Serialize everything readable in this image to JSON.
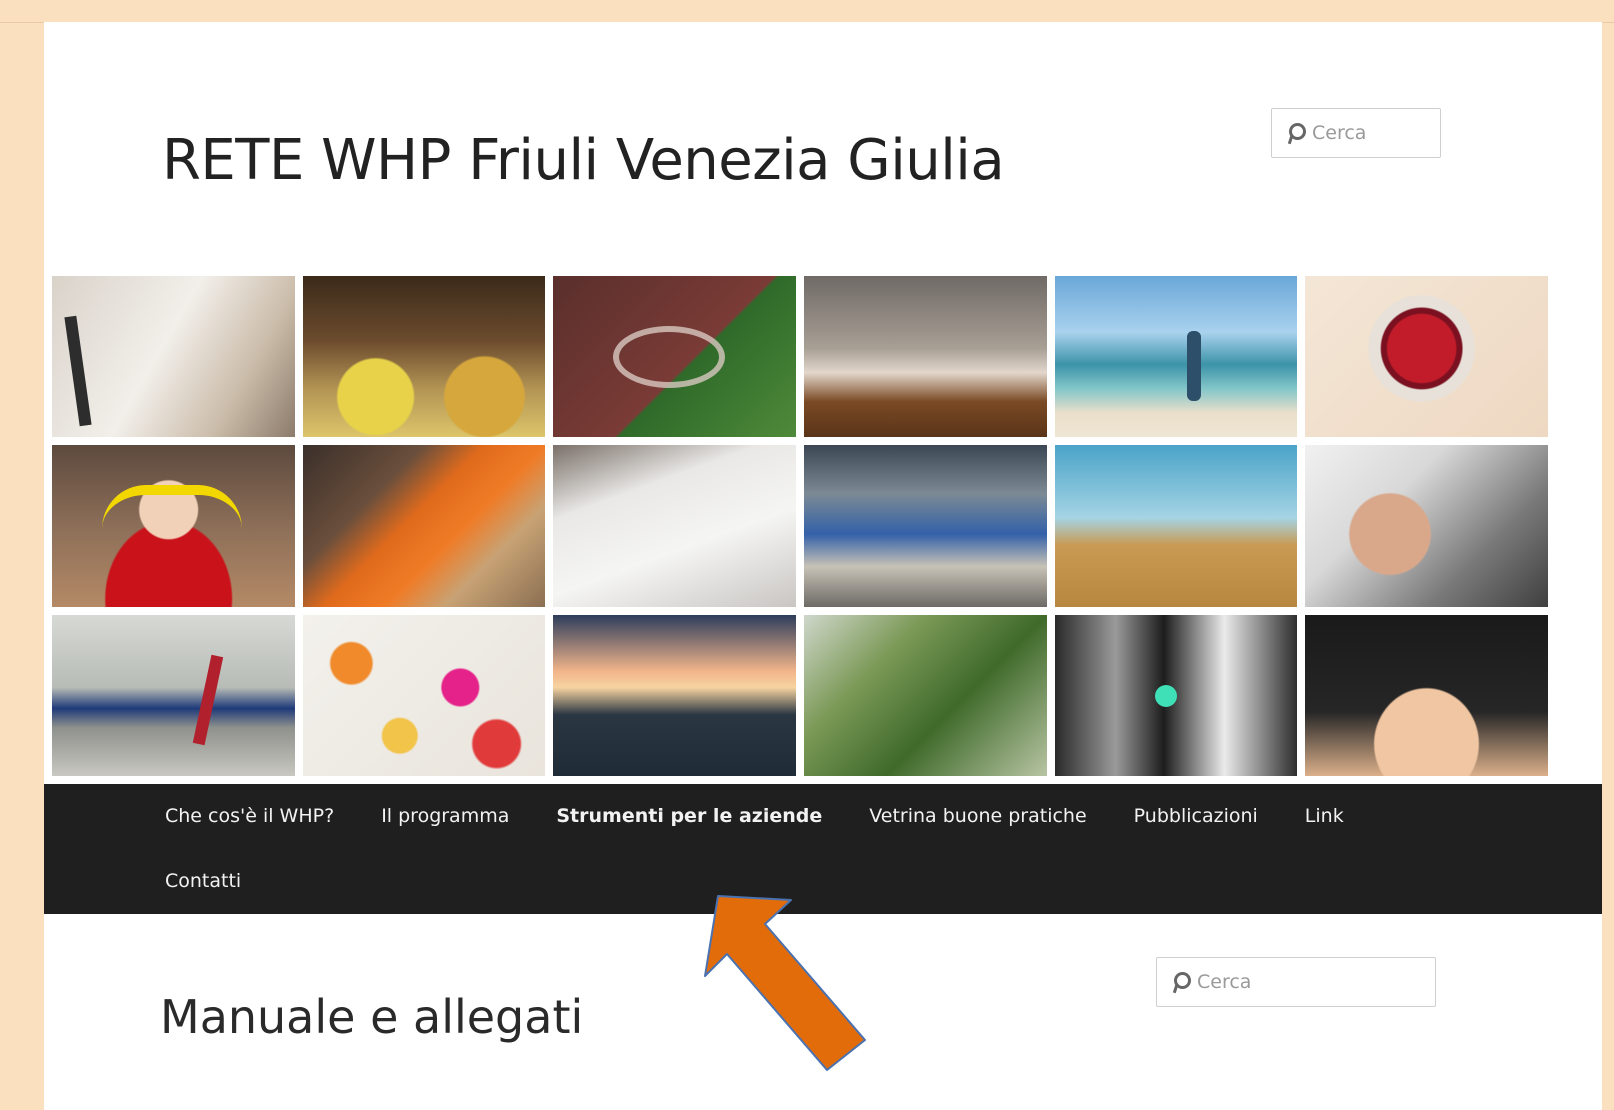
{
  "header": {
    "site_title": "RETE WHP Friuli Venezia Giulia",
    "search_placeholder": "Cerca"
  },
  "banner": {
    "tiles": [
      "bed-image",
      "grain-sacks-image",
      "bike-lane-image",
      "sleeping-man-image",
      "beach-walk-image",
      "berries-bowl-image",
      "ear-protection-image",
      "safety-worker-image",
      "white-interior-image",
      "workshop-image",
      "field-tractor-image",
      "hardhat-worker-image",
      "runner-image",
      "pills-image",
      "sunset-sea-image",
      "asparagus-image",
      "traffic-light-image",
      "breaking-cigarette-image"
    ]
  },
  "nav": {
    "items": [
      {
        "label": "Che cos'è il WHP?",
        "active": false
      },
      {
        "label": "Il programma",
        "active": false
      },
      {
        "label": "Strumenti per le aziende",
        "active": true
      },
      {
        "label": "Vetrina buone pratiche",
        "active": false
      },
      {
        "label": "Pubblicazioni",
        "active": false
      },
      {
        "label": "Link",
        "active": false
      },
      {
        "label": "Contatti",
        "active": false
      }
    ]
  },
  "content": {
    "title": "Manuale e allegati",
    "search_placeholder": "Cerca"
  },
  "annotation": {
    "arrow_color": "#e36c0a",
    "arrow_stroke": "#4a72b0"
  },
  "colors": {
    "frame": "#fbe0c0",
    "nav_background": "#1f1f1f",
    "nav_text": "#f2f2f2"
  }
}
